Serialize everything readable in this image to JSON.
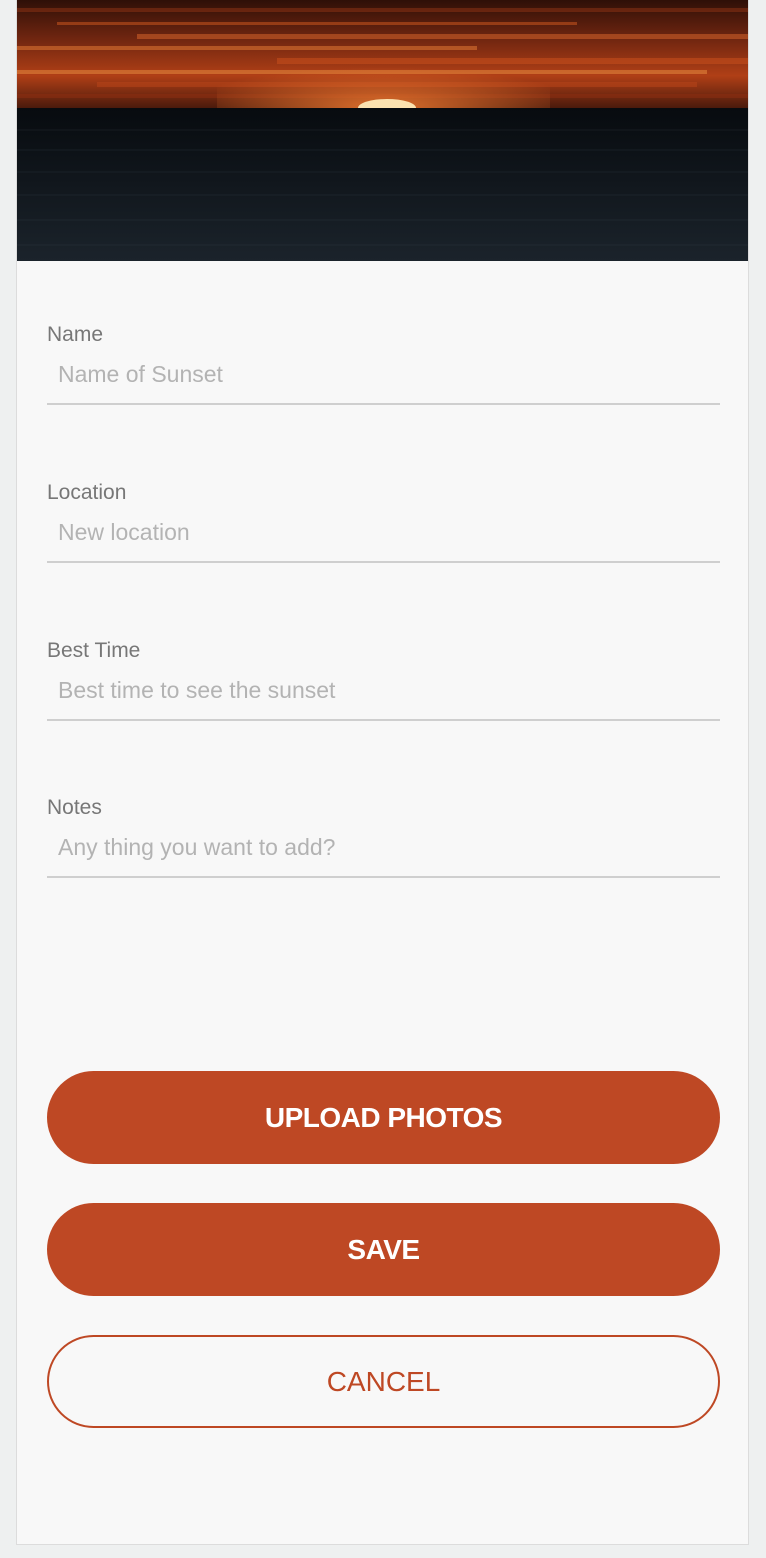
{
  "hero": {
    "image_description_icon": "sunset-over-ocean-image",
    "colors": {
      "sky_top": "#3a1208",
      "sky_mid": "#b23f14",
      "horizon_glow": "#e2662a",
      "sun": "#fbe2b0",
      "sea": "#0d1318"
    }
  },
  "form": {
    "fields": [
      {
        "label": "Name",
        "placeholder": "Name of Sunset",
        "value": ""
      },
      {
        "label": "Location",
        "placeholder": "New location",
        "value": ""
      },
      {
        "label": "Best Time",
        "placeholder": "Best time to see the sunset",
        "value": ""
      },
      {
        "label": "Notes",
        "placeholder": "Any thing you want to add?",
        "value": ""
      }
    ]
  },
  "actions": {
    "upload_label": "UPLOAD PHOTOS",
    "save_label": "SAVE",
    "cancel_label": "CANCEL"
  },
  "colors": {
    "accent": "#be4824",
    "background": "#f8f8f8",
    "label": "#777777",
    "placeholder": "#b3b3b3",
    "divider": "#cfcfcf"
  }
}
